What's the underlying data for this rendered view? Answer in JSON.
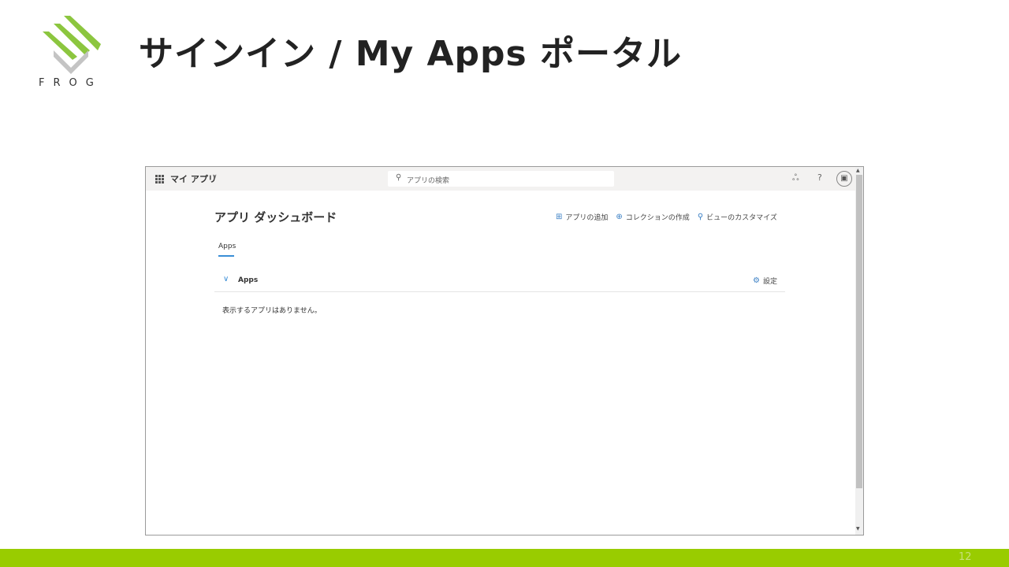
{
  "slide": {
    "logo_text": "FROG",
    "title": "サインイン / My Apps ポータル",
    "page_number": "12",
    "accent_color": "#99cc00"
  },
  "topbar": {
    "app_name": "マイ アプリ",
    "search_placeholder": "アプリの検索",
    "icons": [
      "waffle-icon",
      "org-chart-icon",
      "help-icon",
      "avatar"
    ]
  },
  "dashboard": {
    "title": "アプリ ダッシュボード",
    "actions": [
      {
        "label": "アプリの追加",
        "icon": "add-app-icon"
      },
      {
        "label": "コレクションの作成",
        "icon": "create-collection-icon"
      },
      {
        "label": "ビューのカスタマイズ",
        "icon": "customize-icon"
      }
    ],
    "tab": "Apps",
    "section_label": "Apps",
    "settings_label": "設定",
    "empty_message": "表示するアプリはありません。"
  }
}
